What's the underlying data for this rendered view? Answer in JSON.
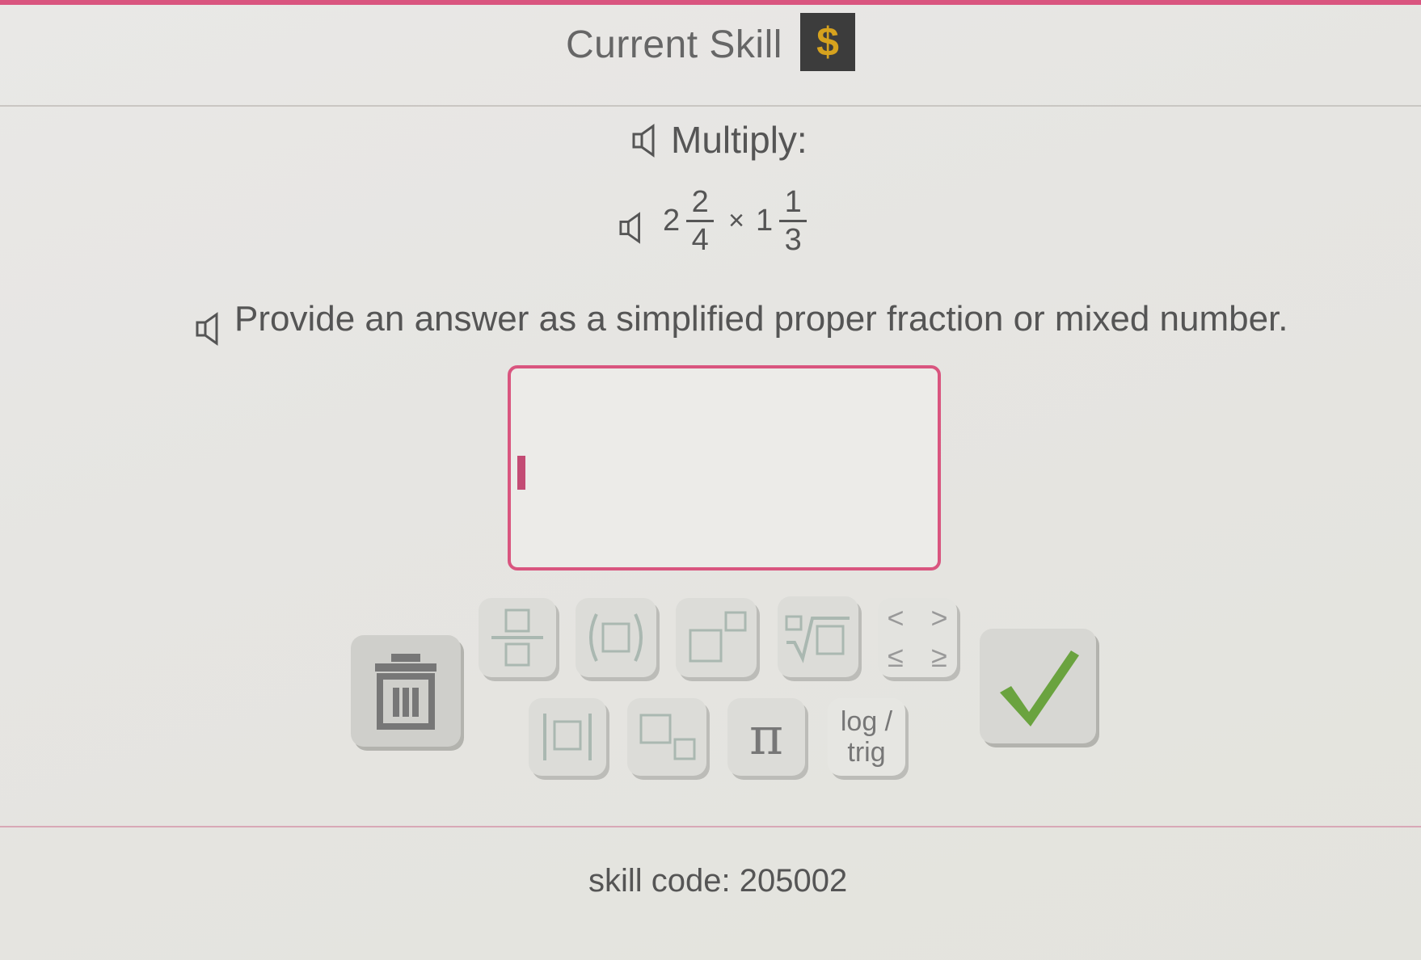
{
  "header": {
    "title": "Current Skill",
    "badge_symbol": "$",
    "badge_color": "#d6a21e"
  },
  "question": {
    "prompt": "Multiply:",
    "problem": {
      "whole1": "2",
      "num1": "2",
      "den1": "4",
      "operator": "×",
      "whole2": "1",
      "num2": "1",
      "den2": "3"
    },
    "instructions": "Provide an answer as a simplified proper fraction or mixed number."
  },
  "answer": {
    "value": "",
    "border_color": "#d9557f"
  },
  "keypad": {
    "row1": [
      "fraction",
      "parentheses",
      "exponent",
      "nth-root",
      "inequalities"
    ],
    "row2": [
      "absolute-value",
      "subscript",
      "pi",
      "log-trig"
    ],
    "inequalities": {
      "lt": "<",
      "gt": ">",
      "le": "≤",
      "ge": "≥"
    },
    "pi_label": "π",
    "log_trig_line1": "log /",
    "log_trig_line2": "trig",
    "delete_icon": "trash-icon",
    "submit_icon": "checkmark-icon",
    "submit_color": "#6aa33f"
  },
  "footer": {
    "skill_code": "skill code: 205002"
  }
}
